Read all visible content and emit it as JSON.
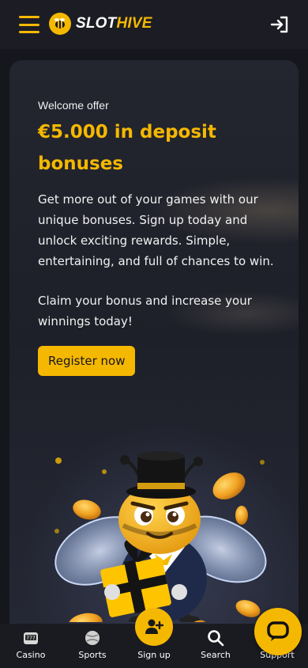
{
  "header": {
    "logo_part1": "SLOT",
    "logo_part2": "HIVE",
    "menu_icon": "hamburger-icon",
    "login_icon": "login-icon"
  },
  "hero": {
    "eyebrow": "Welcome offer",
    "headline": "€5.000 in deposit bonuses",
    "description": "Get more out of your games with our unique bonuses. Sign up today and unlock exciting rewards. Simple, entertaining, and full of chances to win.",
    "description2": "Claim your bonus and increase your winnings today!",
    "cta_label": "Register now",
    "image": "bee-mascot-with-gift"
  },
  "bottom_nav": {
    "items": [
      {
        "label": "Casino",
        "icon": "slot-machine-icon"
      },
      {
        "label": "Sports",
        "icon": "ball-icon"
      },
      {
        "label": "Sign up",
        "icon": "add-user-icon"
      },
      {
        "label": "Search",
        "icon": "search-icon"
      },
      {
        "label": "Support",
        "icon": "chat-icon"
      }
    ]
  },
  "colors": {
    "accent": "#f5b800",
    "background": "#16171d",
    "header": "#1c1d24"
  }
}
